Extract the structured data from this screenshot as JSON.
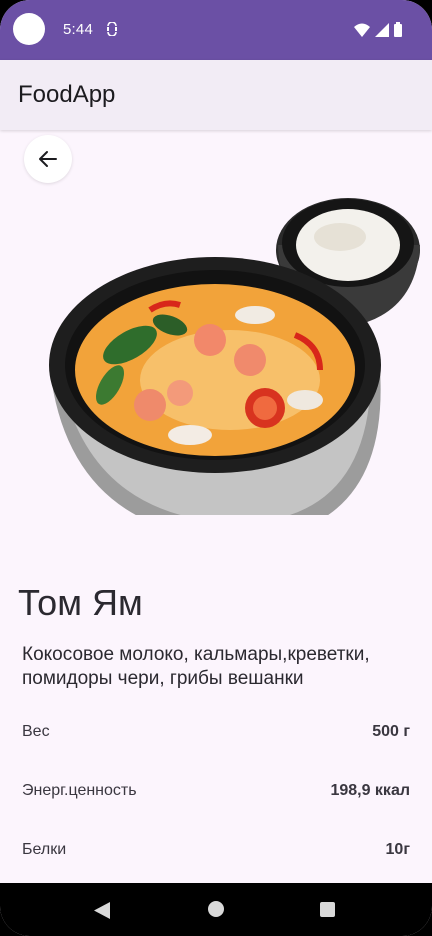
{
  "status_bar": {
    "time": "5:44",
    "icons": [
      "camera-cutout",
      "sync-icon",
      "wifi-icon",
      "signal-icon",
      "battery-icon"
    ],
    "color": "#6b50a5"
  },
  "app_bar": {
    "title": "FoodApp"
  },
  "product": {
    "back_icon": "arrow-left-icon",
    "image": "tom-yam-soup-with-rice",
    "name": "Том Ям",
    "description": "Кокосовое молоко, кальмары,креветки, помидоры чери, грибы вешанки",
    "nutrition": [
      {
        "label": "Вес",
        "value": "500 г"
      },
      {
        "label": "Энерг.ценность",
        "value": "198,9 ккал"
      },
      {
        "label": "Белки",
        "value": "10г"
      }
    ]
  },
  "nav_bar": {
    "icons": [
      "nav-back-icon",
      "nav-home-icon",
      "nav-recents-icon"
    ]
  }
}
